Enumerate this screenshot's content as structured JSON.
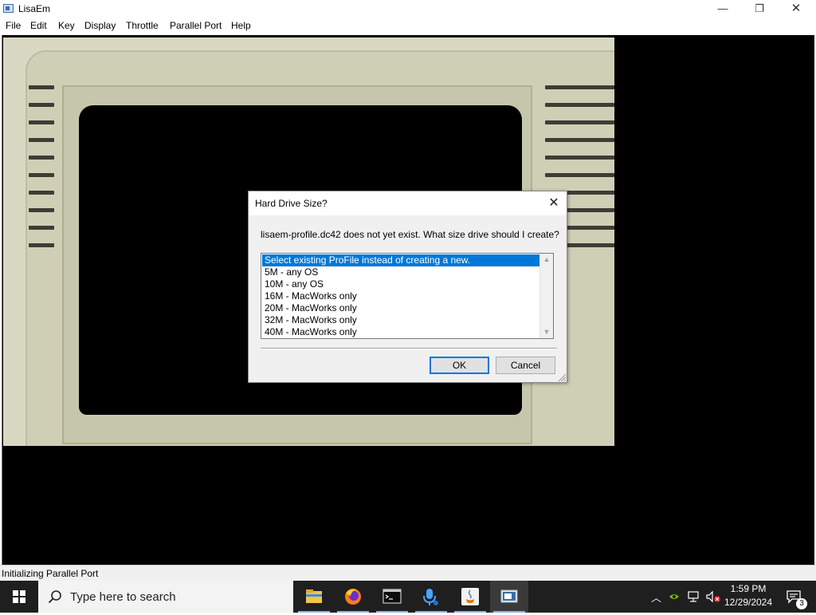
{
  "window": {
    "title": "LisaEm",
    "controls": {
      "minimize": "—",
      "maximize": "❐",
      "close": "✕"
    }
  },
  "menu": {
    "items": [
      {
        "label": "File"
      },
      {
        "label": "Edit"
      },
      {
        "label": "Key"
      },
      {
        "label": "Display"
      },
      {
        "label": "Throttle"
      },
      {
        "label": "Parallel Port"
      },
      {
        "label": "Help"
      }
    ]
  },
  "dialog": {
    "title": "Hard Drive Size?",
    "close_glyph": "✕",
    "message": "lisaem-profile.dc42 does not yet exist.  What size drive should I create?",
    "options": [
      {
        "label": "Select existing ProFile instead of creating a new.",
        "selected": true
      },
      {
        "label": "5M - any OS",
        "selected": false
      },
      {
        "label": "10M - any OS",
        "selected": false
      },
      {
        "label": "16M - MacWorks only",
        "selected": false
      },
      {
        "label": "20M - MacWorks only",
        "selected": false
      },
      {
        "label": "32M - MacWorks only",
        "selected": false
      },
      {
        "label": "40M - MacWorks only",
        "selected": false
      }
    ],
    "ok_label": "OK",
    "cancel_label": "Cancel"
  },
  "status": {
    "text": "Initializing Parallel Port"
  },
  "taskbar": {
    "search_placeholder": "Type here to search",
    "apps": [
      {
        "icon": "file-explorer-icon"
      },
      {
        "icon": "firefox-icon"
      },
      {
        "icon": "terminal-icon"
      },
      {
        "icon": "voice-recorder-icon"
      },
      {
        "icon": "java-icon"
      },
      {
        "icon": "lisaem-icon"
      }
    ],
    "clock": {
      "time": "1:59 PM",
      "date": "12/29/2024"
    },
    "notifications_count": "3"
  },
  "colors": {
    "accent": "#0078d7",
    "taskbar": "#1f1f1f",
    "bezel": "#d9d8c2"
  }
}
